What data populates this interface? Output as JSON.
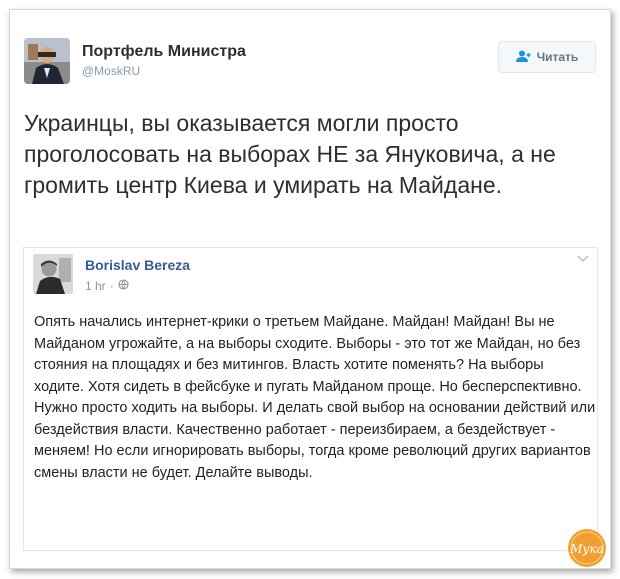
{
  "tweet": {
    "author_name": "Портфель Министра",
    "author_handle": "@MoskRU",
    "follow_label": "Читать",
    "text": "Украинцы, вы оказывается могли просто проголосовать на выборах НЕ за Януковича, а не громить центр Киева и умирать на Майдане."
  },
  "quoted_post": {
    "author_name": "Borislav Bereza",
    "time": "1 hr",
    "separator": "·",
    "text": "Опять начались интернет-крики о третьем Майдане. Майдан! Майдан! Вы не Майданом угрожайте, а на выборы сходите. Выборы - это тот же Майдан, но без стояния на площадях и без митингов. Власть хотите поменять? На выборы ходите. Хотя сидеть в фейсбуке и пугать Майданом проще. Но бесперспективно. Нужно просто ходить на выборы. И делать свой выбор на основании действий или бездействия власти. Качественно работает - переизбираем, а бездействует - меняем! Но если игнорировать выборы, тогда кроме революций других вариантов смены власти не будет. Делайте выводы."
  },
  "watermark": {
    "text": "Мука"
  },
  "icons": {
    "follow": "follow-user-icon",
    "privacy": "globe-icon",
    "menu": "chevron-down-icon"
  },
  "colors": {
    "follow_accent": "#1b95e0",
    "facebook_name": "#3b5998",
    "watermark": "#f0a030"
  }
}
